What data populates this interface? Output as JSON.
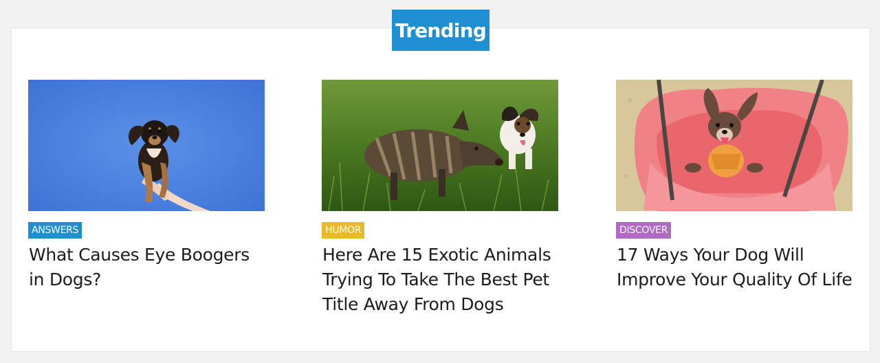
{
  "section": {
    "title": "Trending",
    "title_bg": "#1e90d2"
  },
  "cards": [
    {
      "category": "ANSWERS",
      "category_color": "#1e90d2",
      "headline": "What Causes Eye Boogers in Dogs?",
      "image_subject": "dachshund-puppy-held-on-blue-background"
    },
    {
      "category": "HUMOR",
      "category_color": "#e8b928",
      "headline": "Here Are 15 Exotic Animals Trying To Take The Best Pet Title Away From Dogs",
      "image_subject": "wild-boar-piglet-and-terrier-in-grass"
    },
    {
      "category": "DISCOVER",
      "category_color": "#b06ac4",
      "headline": "17 Ways Your Dog Will Improve Your Quality Of Life",
      "image_subject": "chihuahua-on-pink-swing"
    }
  ]
}
